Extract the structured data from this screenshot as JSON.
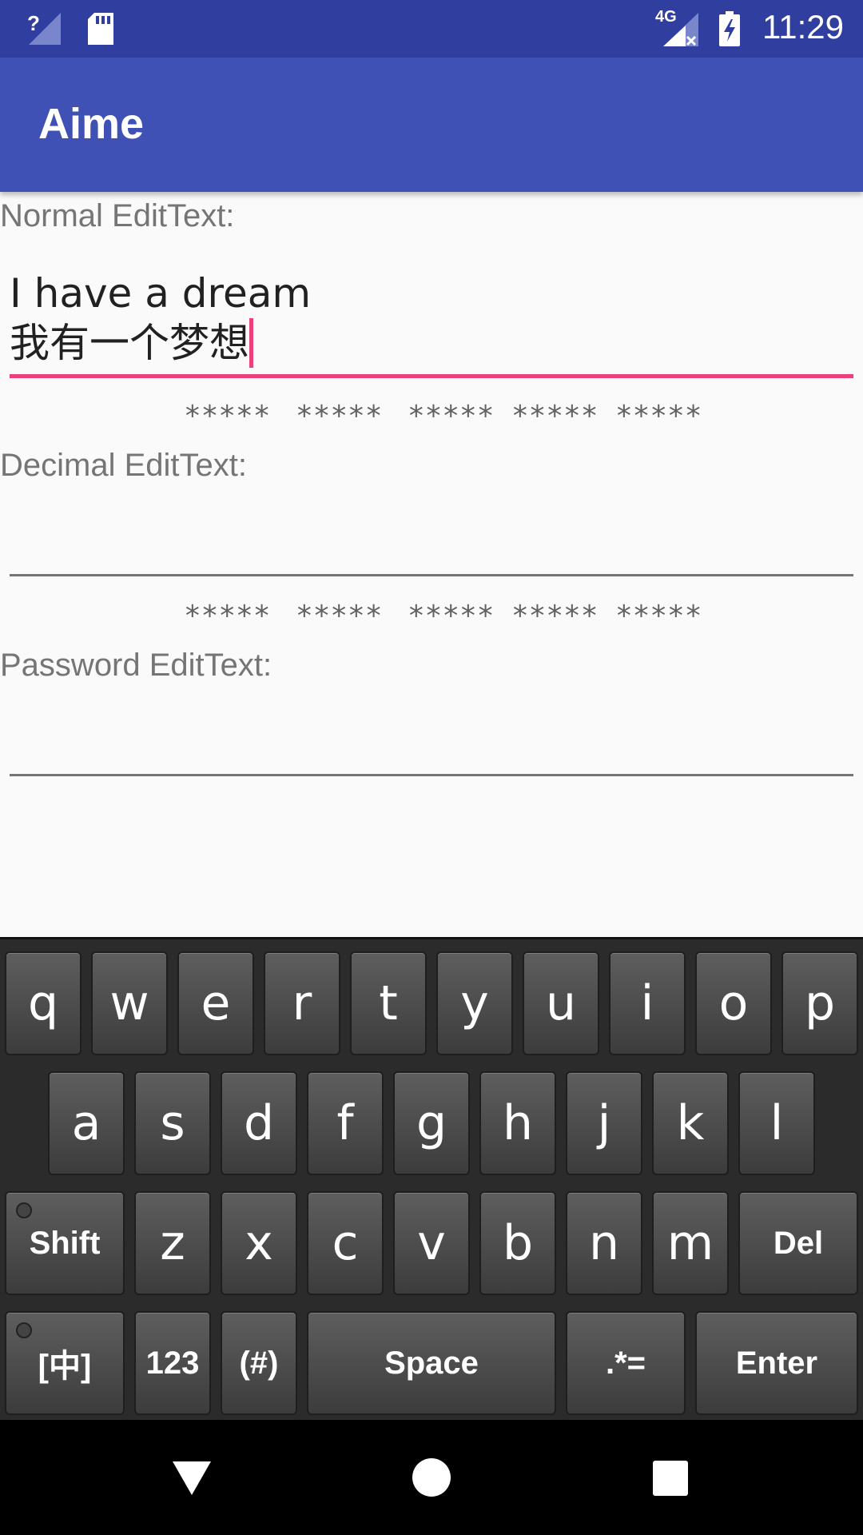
{
  "status_bar": {
    "time": "11:29",
    "network_label": "4G",
    "icons": [
      "signal-unknown-icon",
      "sd-card-icon",
      "signal-4g-icon",
      "battery-charging-icon"
    ]
  },
  "app": {
    "title": "Aime"
  },
  "fields": [
    {
      "label": "Normal EditText:",
      "value_line1": "I have a dream",
      "value_line2": "我有一个梦想",
      "focused": true
    },
    {
      "label": "Decimal EditText:",
      "value": ""
    },
    {
      "label": "Password EditText:",
      "value": ""
    }
  ],
  "separators": {
    "row1": [
      "*****",
      "*****",
      "*****",
      "*****",
      "*****"
    ],
    "row2": [
      "*****",
      "*****",
      "*****",
      "*****",
      "*****"
    ]
  },
  "keyboard": {
    "row1": [
      "q",
      "w",
      "e",
      "r",
      "t",
      "y",
      "u",
      "i",
      "o",
      "p"
    ],
    "row2": [
      "a",
      "s",
      "d",
      "f",
      "g",
      "h",
      "j",
      "k",
      "l"
    ],
    "row3": {
      "shift": "Shift",
      "letters": [
        "z",
        "x",
        "c",
        "v",
        "b",
        "n",
        "m"
      ],
      "del": "Del"
    },
    "row4": {
      "lang": "[中]",
      "num": "123",
      "sym": "(#)",
      "space": "Space",
      "punct": ".*=",
      "enter": "Enter"
    }
  },
  "colors": {
    "status_bar": "#303f9f",
    "app_bar": "#3f51b5",
    "accent": "#ec407a",
    "background": "#fafafa"
  },
  "nav": {
    "icons": [
      "back-icon",
      "home-icon",
      "recents-icon"
    ]
  }
}
